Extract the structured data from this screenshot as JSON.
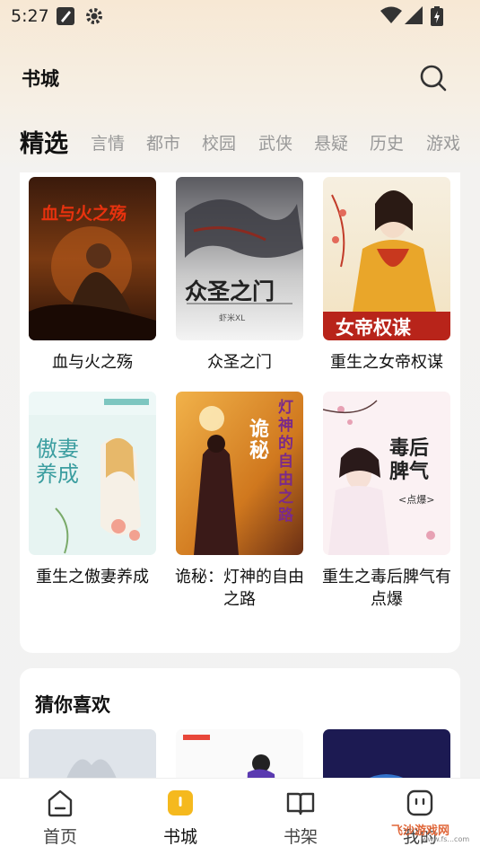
{
  "status": {
    "time": "5:27",
    "icons": [
      "edit-note-icon",
      "settings-gear-icon",
      "wifi-icon",
      "signal-icon",
      "battery-charging-icon"
    ]
  },
  "header": {
    "title": "书城",
    "search_icon": "search-icon"
  },
  "tabs": [
    {
      "label": "精选",
      "active": true
    },
    {
      "label": "言情",
      "active": false
    },
    {
      "label": "都市",
      "active": false
    },
    {
      "label": "校园",
      "active": false
    },
    {
      "label": "武侠",
      "active": false
    },
    {
      "label": "悬疑",
      "active": false
    },
    {
      "label": "历史",
      "active": false
    },
    {
      "label": "游戏",
      "active": false
    }
  ],
  "books": [
    {
      "title": "血与火之殇",
      "cover_text": "血与火之殇"
    },
    {
      "title": "众圣之门",
      "cover_text": "众圣之门",
      "cover_author": "虾米XL"
    },
    {
      "title": "重生之女帝权谋",
      "cover_text": "女帝权谋"
    },
    {
      "title": "重生之傲妻养成",
      "cover_text": "傲妻养成"
    },
    {
      "title": "诡秘：灯神的自由之路",
      "cover_text": "诡秘",
      "cover_text2": "灯神的自由之路"
    },
    {
      "title": "重生之毒后脾气有点爆",
      "cover_text": "毒后脾气",
      "cover_sub": "<点爆>"
    }
  ],
  "recommend": {
    "title": "猜你喜欢"
  },
  "nav": [
    {
      "label": "首页",
      "icon": "home-icon",
      "active": false
    },
    {
      "label": "书城",
      "icon": "bookstore-icon",
      "active": true
    },
    {
      "label": "书架",
      "icon": "open-book-icon",
      "active": false
    },
    {
      "label": "我的",
      "icon": "profile-face-icon",
      "active": false
    }
  ],
  "watermark": {
    "text": "飞沙游戏网",
    "sub": "www.fs...com"
  },
  "colors": {
    "accent": "#f5b91e",
    "tab_inactive": "#999999",
    "text": "#111111"
  }
}
